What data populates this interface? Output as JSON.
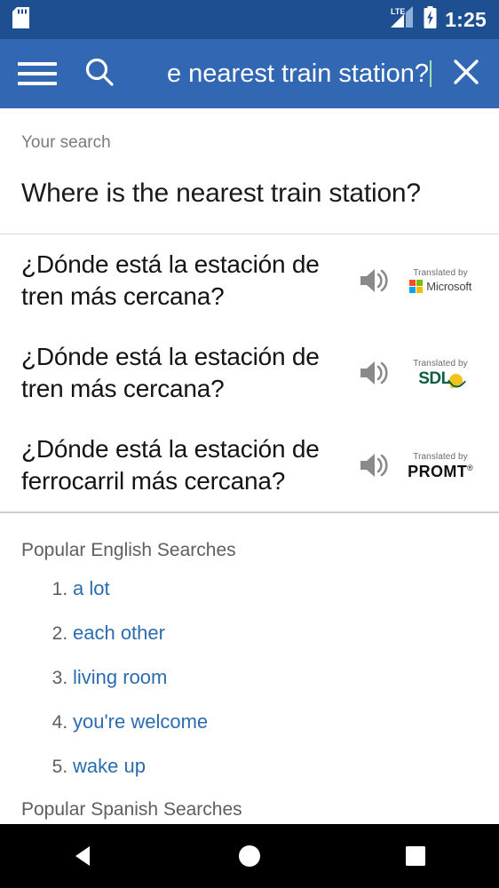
{
  "status_bar": {
    "sd_card_icon": "sd-card-icon",
    "network_label": "LTE",
    "signal_icon": "signal-bars-icon",
    "battery_icon": "battery-charging-icon",
    "time": "1:25",
    "background_color": "#1d4f91",
    "text_color": "#ffffff"
  },
  "app_bar": {
    "menu_icon": "hamburger-menu-icon",
    "search_icon": "search-icon",
    "close_icon": "close-icon",
    "search_value": "e nearest train station?",
    "search_placeholder": "Search",
    "background_color": "#3267b3",
    "caret_color": "#9fdfb0"
  },
  "your_search": {
    "label": "Your search",
    "query": "Where is the nearest train station?"
  },
  "results": [
    {
      "text": "¿Dónde está la estación de tren más cercana?",
      "speaker_icon": "speaker-icon",
      "provider_caption": "Translated by",
      "provider_name": "Microsoft",
      "provider_logo": "microsoft-logo",
      "logo_colors": [
        "#f25022",
        "#7fba00",
        "#00a4ef",
        "#ffb900"
      ]
    },
    {
      "text": "¿Dónde está la estación de tren más cercana?",
      "speaker_icon": "speaker-icon",
      "provider_caption": "Translated by",
      "provider_name": "SDL",
      "provider_logo": "sdl-logo",
      "logo_colors": [
        "#0b5f3f",
        "#f0c419"
      ]
    },
    {
      "text": "¿Dónde está la estación de ferrocarril más cercana?",
      "speaker_icon": "speaker-icon",
      "provider_caption": "Translated by",
      "provider_name": "PROMT",
      "provider_trademark": "®",
      "provider_logo": "promt-logo",
      "logo_colors": [
        "#111111"
      ]
    }
  ],
  "popular_english": {
    "title": "Popular English Searches",
    "items": [
      {
        "number": "1.",
        "label": "a lot"
      },
      {
        "number": "2.",
        "label": "each other"
      },
      {
        "number": "3.",
        "label": "living room"
      },
      {
        "number": "4.",
        "label": "you're welcome"
      },
      {
        "number": "5.",
        "label": "wake up"
      }
    ],
    "link_color": "#2b6cb0"
  },
  "popular_spanish": {
    "title": "Popular Spanish Searches"
  },
  "nav_bar": {
    "back_icon": "back-triangle-icon",
    "home_icon": "home-circle-icon",
    "recents_icon": "recents-square-icon",
    "background_color": "#000000"
  }
}
